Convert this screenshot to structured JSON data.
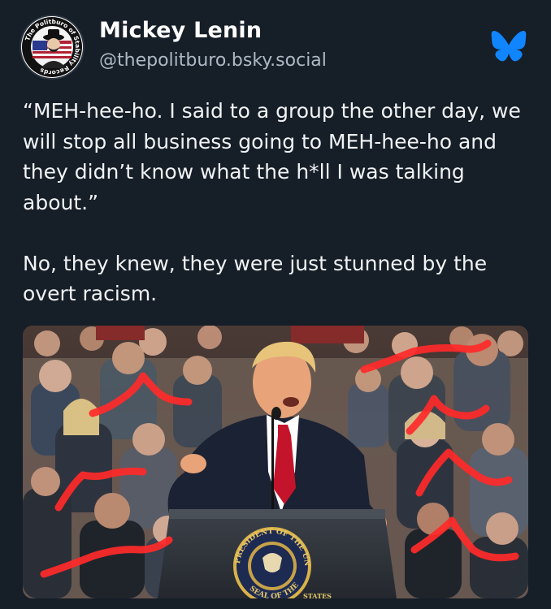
{
  "post": {
    "author": {
      "display_name": "Mickey Lenin",
      "handle": "@thepolitburo.bsky.social",
      "avatar_ring_text": "The Politburo of Stability Records"
    },
    "platform_icon": "bluesky-butterfly-icon",
    "text": {
      "paragraph_1": "“MEH-hee-ho.  I said to a group the other day, we will stop all business going to MEH-hee-ho and they didn’t know what the h*ll I was talking about.”",
      "paragraph_2": "No, they knew, they were just stunned by the overt racism."
    },
    "image": {
      "seal_text_top": "PRESIDENT OF THE UNITED",
      "seal_text_bottom": "SEAL OF THE",
      "seal_text_side": "STATES"
    }
  },
  "colors": {
    "background": "#161e27",
    "text": "#f1f3f5",
    "handle_text": "#aeb9c5",
    "bluesky_blue": "#1185fe",
    "scribble_red": "#ff2a2a"
  }
}
